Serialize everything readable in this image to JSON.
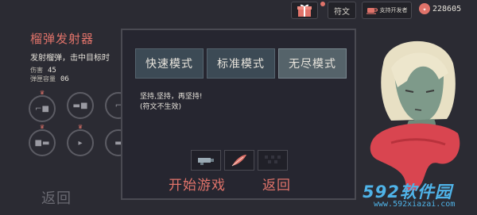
{
  "weapon": {
    "title": "榴弹发射器",
    "description": "发射榴弹，击中目标时",
    "damage_label": "伤害",
    "damage_value": "45",
    "capacity_label": "弹匣容量",
    "capacity_value": "06"
  },
  "upgrade_slots": [
    {
      "icon": "grenade-launcher-icon",
      "glyph": "⌐■"
    },
    {
      "icon": "rifle-icon",
      "glyph": "▬■"
    },
    {
      "icon": "upgrade-icon",
      "glyph": "⌐"
    },
    {
      "icon": "shotgun-icon",
      "glyph": "■▬"
    },
    {
      "icon": "dagger-icon",
      "glyph": "▸"
    },
    {
      "icon": "sniper-icon",
      "glyph": "▬"
    }
  ],
  "back_label": "返回",
  "topbar": {
    "gift_icon": "gift-box-icon",
    "rune_label": "符文",
    "support_label": "支持开发者",
    "coins": "228605"
  },
  "modal": {
    "modes": [
      "快速模式",
      "标准模式",
      "无尽模式"
    ],
    "selected_mode": "无尽模式",
    "description_line1": "坚持,坚持，再坚持!",
    "description_line2": "(符文不生效)",
    "runes": [
      "gun-rune-icon",
      "feather-rune-icon",
      "empty-rune-slot"
    ],
    "start_label": "开始游戏",
    "back_label": "返回"
  },
  "watermark": {
    "logo": "592软件园",
    "url": "www.592xiazai.com"
  },
  "colors": {
    "accent": "#e0736a",
    "background": "#2b2b33",
    "mode_button": "#3c4a55",
    "mode_selected": "#55636a",
    "watermark": "#4fb3e8"
  }
}
